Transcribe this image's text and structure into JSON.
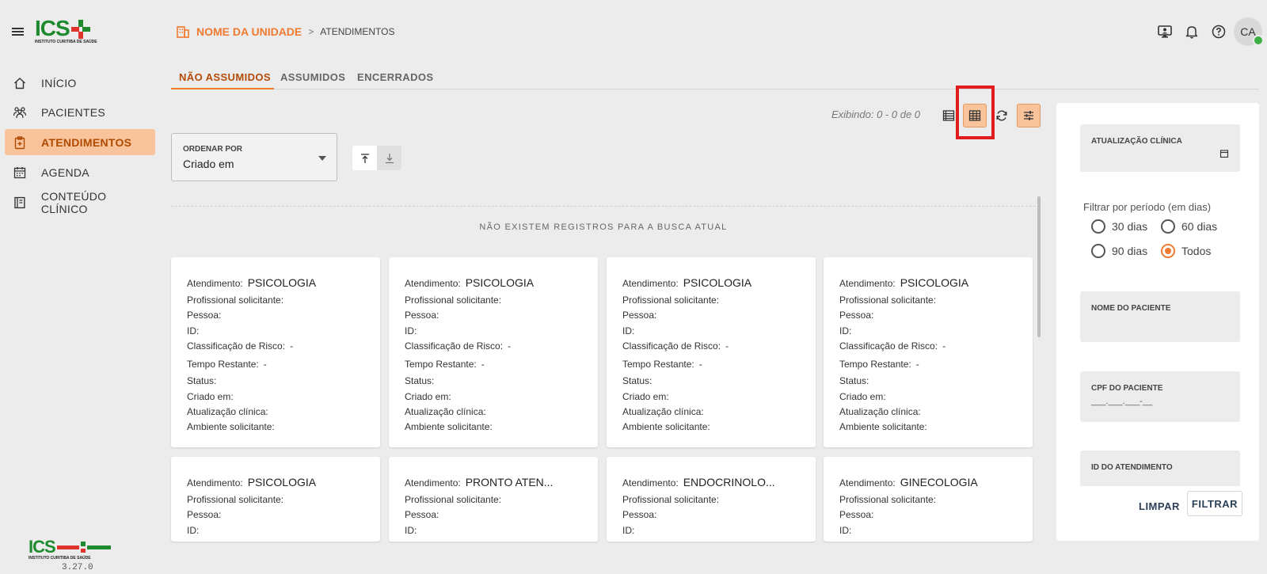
{
  "app": {
    "logo_text": "ICS",
    "logo_subtitle": "INSTITUTO CURITIBA DE SAÚDE",
    "version": "3.27.0"
  },
  "breadcrumb": {
    "unit": "NOME DA UNIDADE",
    "separator": ">",
    "page": "ATENDIMENTOS"
  },
  "user": {
    "initials": "CA"
  },
  "sidebar": {
    "items": [
      {
        "label": "INÍCIO",
        "icon": "home-icon"
      },
      {
        "label": "PACIENTES",
        "icon": "patients-icon"
      },
      {
        "label": "ATENDIMENTOS",
        "icon": "clipboard-icon",
        "active": true
      },
      {
        "label": "AGENDA",
        "icon": "calendar-icon"
      },
      {
        "label": "CONTEÚDO CLÍNICO",
        "icon": "book-icon"
      }
    ]
  },
  "tabs": [
    {
      "label": "NÃO ASSUMIDOS",
      "active": true
    },
    {
      "label": "ASSUMIDOS"
    },
    {
      "label": "ENCERRADOS"
    }
  ],
  "toolbar": {
    "showing": "Exibindo: 0 - 0 de 0"
  },
  "order": {
    "label": "ORDENAR POR",
    "value": "Criado em"
  },
  "results": {
    "empty_message": "NÃO EXISTEM REGISTROS PARA A BUSCA ATUAL"
  },
  "card_labels": {
    "atendimento": "Atendimento:",
    "profissional": "Profissional solicitante:",
    "pessoa": "Pessoa:",
    "id": "ID:",
    "classificacao": "Classificação de Risco:",
    "tempo": "Tempo Restante:",
    "status": "Status:",
    "criado": "Criado em:",
    "atualizacao": "Atualização clínica:",
    "ambiente": "Ambiente solicitante:"
  },
  "cards": [
    {
      "atendimento": "PSICOLOGIA",
      "classificacao": "-",
      "tempo": "-"
    },
    {
      "atendimento": "PSICOLOGIA",
      "classificacao": "-",
      "tempo": "-"
    },
    {
      "atendimento": "PSICOLOGIA",
      "classificacao": "-",
      "tempo": "-"
    },
    {
      "atendimento": "PSICOLOGIA",
      "classificacao": "-",
      "tempo": "-"
    },
    {
      "atendimento": "PSICOLOGIA"
    },
    {
      "atendimento": "PRONTO ATEN..."
    },
    {
      "atendimento": "ENDOCRINOLO..."
    },
    {
      "atendimento": "GINECOLOGIA"
    }
  ],
  "filters": {
    "clinical_update_label": "ATUALIZAÇÃO CLÍNICA",
    "period_label": "Filtrar por período (em dias)",
    "period_options": [
      "30 dias",
      "60 dias",
      "90 dias",
      "Todos"
    ],
    "period_selected": "Todos",
    "patient_name_label": "NOME DO PACIENTE",
    "cpf_label": "CPF DO PACIENTE",
    "cpf_placeholder": "___.___.___-__",
    "attendance_id_label": "ID DO ATENDIMENTO",
    "clear_label": "LIMPAR",
    "filter_label": "FILTRAR"
  },
  "colors": {
    "accent": "#f07a30",
    "active_nav_bg": "#f9c49b",
    "logo_green": "#1e8a2e",
    "highlight_red": "#e01b1b",
    "online_green": "#3cb043"
  }
}
